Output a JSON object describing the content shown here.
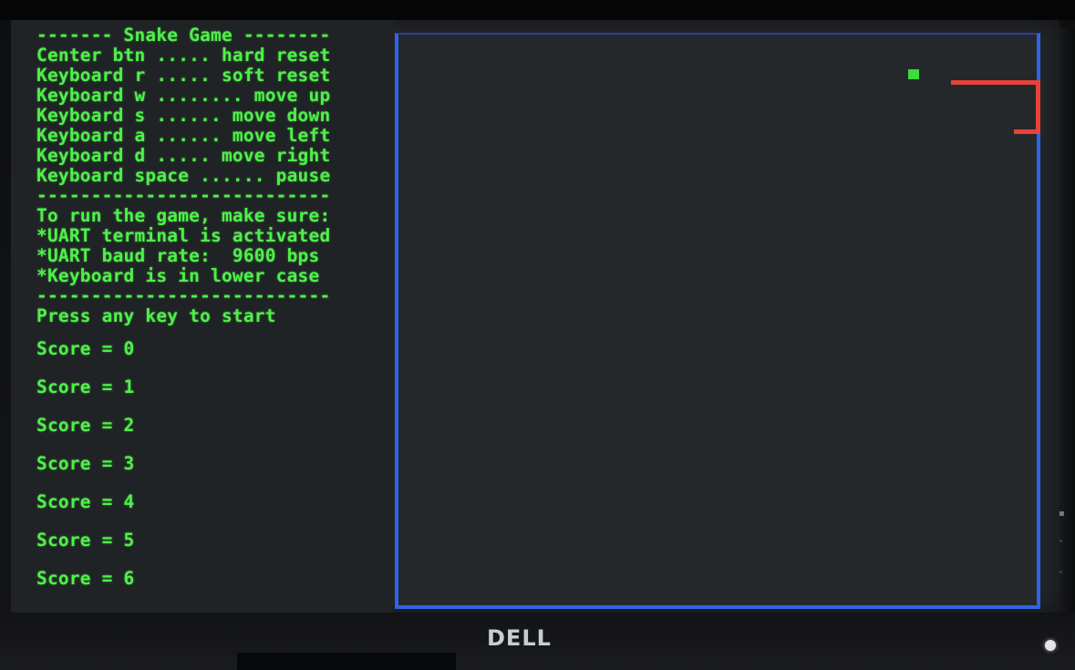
{
  "terminal": {
    "lines": [
      "------- Snake Game --------",
      "Center btn ..... hard reset",
      "Keyboard r ..... soft reset",
      "Keyboard w ........ move up",
      "Keyboard s ...... move down",
      "Keyboard a ...... move left",
      "Keyboard d ..... move right",
      "Keyboard space ...... pause",
      "---------------------------",
      "To run the game, make sure:",
      "*UART terminal is activated",
      "*UART baud rate:  9600 bps",
      "*Keyboard is in lower case",
      "---------------------------",
      "Press any key to start"
    ],
    "scores": [
      "Score = 0",
      "Score = 1",
      "Score = 2",
      "Score = 3",
      "Score = 4",
      "Score = 5",
      "Score = 6"
    ]
  },
  "game": {
    "border_color": "#2f63e8",
    "snake_color": "#e8423a",
    "food_color": "#3ddc3a"
  },
  "monitor": {
    "brand": "DELL"
  }
}
